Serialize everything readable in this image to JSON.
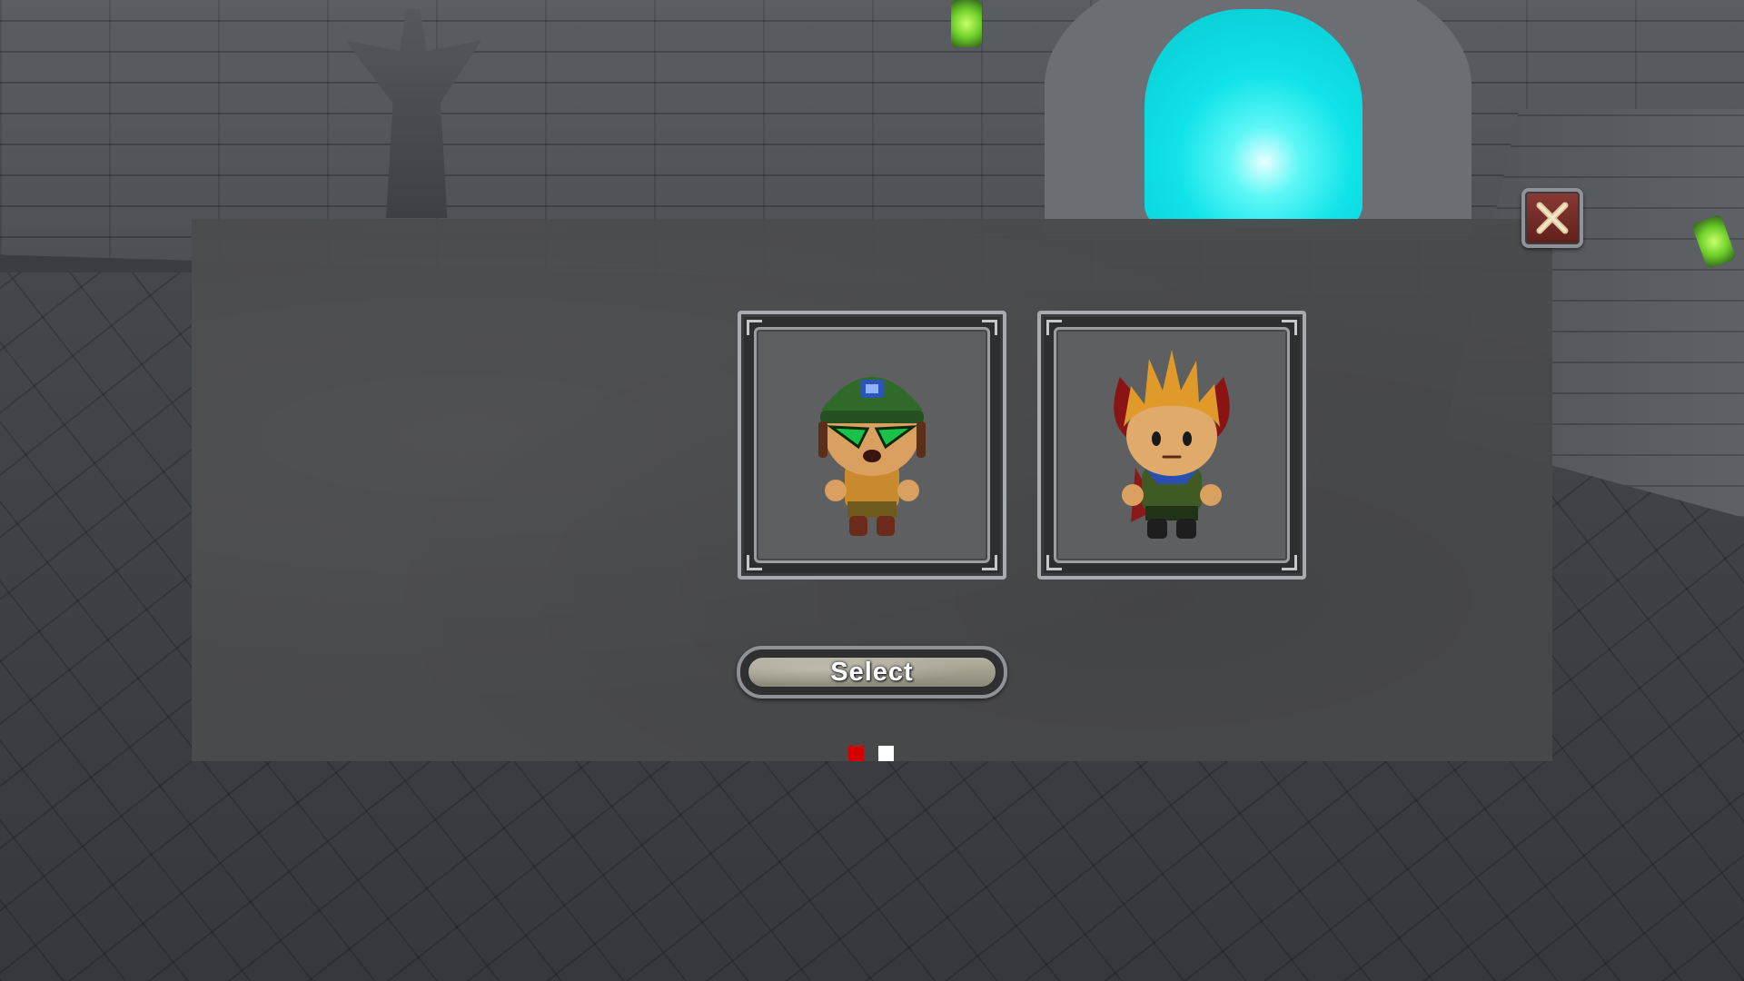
{
  "character_select": {
    "characters": [
      {
        "icon": "green-helmet-goggles-hero-icon"
      },
      {
        "icon": "spiky-hair-horned-hero-icon"
      }
    ],
    "select_label": "Select",
    "page_indicator": {
      "total": 2,
      "active": 1
    },
    "close_icon": "close-icon"
  },
  "colors": {
    "portal": "#10e3e8",
    "active_dot": "#d40000",
    "inactive_dot": "#ffffff",
    "close_button": "#7a2d28",
    "dialog_bg": "#4a4b4d"
  }
}
